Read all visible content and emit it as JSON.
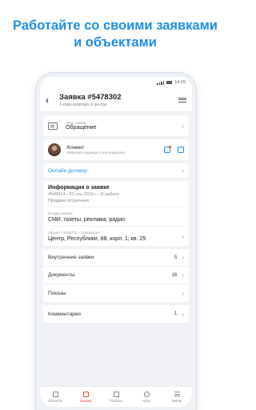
{
  "headline": {
    "line1": "Работайте со своими заявками",
    "line2": "и объектами"
  },
  "status": {
    "time": "14:15"
  },
  "appbar": {
    "title": "Заявка #5478302",
    "subtitle": "1-комн квартира в центре"
  },
  "topic": {
    "label": "Этап заявки",
    "value": "Обращение"
  },
  "client": {
    "title": "Клиент",
    "name": "Иванова Надежда Александровна"
  },
  "online": {
    "label": "Онлайн договор"
  },
  "info": {
    "title": "Информация о заявке",
    "meta": "#543914 • 22 сен 2019 г. • В работе",
    "type": "Продажа вторичная",
    "source_label": "Откуда узнали",
    "source_value": "СМИ, газеты, реклама, радио",
    "object_label": "Объект • #542731 • Предлагает",
    "object_value": "Центр, Республики, 88, корп. 1, кв. 25"
  },
  "lists": [
    {
      "label": "Внутренние заявки",
      "count": "5"
    },
    {
      "label": "Документы",
      "count": "16"
    },
    {
      "label": "Показы",
      "count": ""
    }
  ],
  "comments": {
    "label": "Комментарии",
    "count": "1"
  },
  "tabs": [
    {
      "label": "Объекты"
    },
    {
      "label": "Заявки"
    },
    {
      "label": "Показы"
    },
    {
      "label": "Чаты"
    },
    {
      "label": "Меню"
    }
  ],
  "colors": {
    "accent": "#1e8ee6",
    "active_tab": "#e8503a"
  }
}
